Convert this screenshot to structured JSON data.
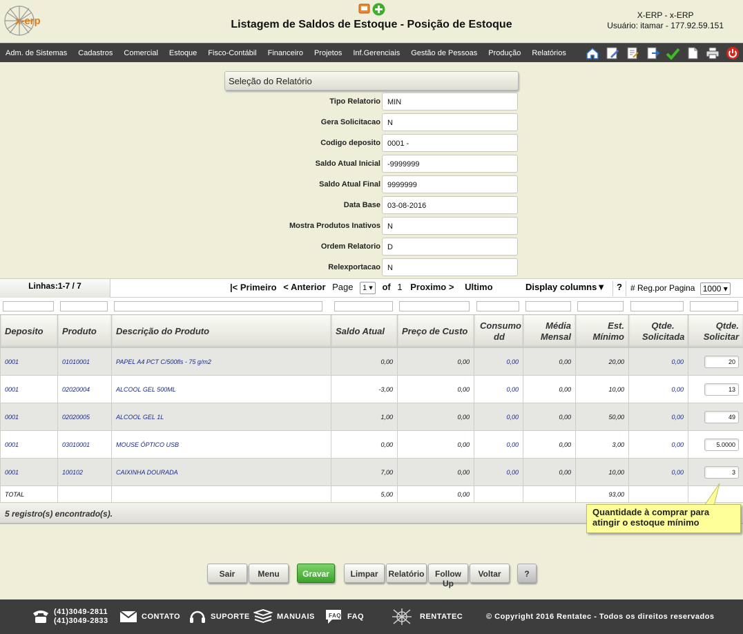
{
  "header": {
    "logo_text": "x-erp",
    "title": "Listagem de Saldos de Estoque - Posição de Estoque",
    "system": "X-ERP - x-ERP",
    "user": "Usuário: itamar - 177.92.59.151"
  },
  "menu": [
    "Adm. de Sistemas",
    "Cadastros",
    "Comercial",
    "Estoque",
    "Fisco-Contábil",
    "Financeiro",
    "Projetos",
    "Inf.Gerenciais",
    "Gestão de Pessoas",
    "Produção",
    "Relatórios"
  ],
  "toolbar_icons": [
    "home-icon",
    "edit-icon",
    "document-edit-icon",
    "export-icon",
    "check-icon",
    "page-icon",
    "print-icon",
    "power-icon"
  ],
  "selection": {
    "title": "Seleção do Relatório",
    "fields": [
      {
        "label": "Tipo Relatorio",
        "value": "MIN"
      },
      {
        "label": "Gera Solicitacao",
        "value": "N"
      },
      {
        "label": "Codigo deposito",
        "value": "0001 -"
      },
      {
        "label": "Saldo Atual Inicial",
        "value": "-9999999"
      },
      {
        "label": "Saldo Atual Final",
        "value": "9999999"
      },
      {
        "label": "Data Base",
        "value": "03-08-2016"
      },
      {
        "label": "Mostra Produtos Inativos",
        "value": "N"
      },
      {
        "label": "Ordem Relatorio",
        "value": "D"
      },
      {
        "label": "Relexportacao",
        "value": "N"
      }
    ]
  },
  "pager": {
    "lines": "Linhas:1-7 / 7",
    "first": "|< Primeiro",
    "prev": "< Anterior",
    "page_label": "Page",
    "page": "1",
    "of": "of",
    "total_pages": "1",
    "next": "Proximo >",
    "last": "Ultimo",
    "display_columns": "Display columns▼",
    "help": "?",
    "reg_label": "# Reg.por Pagina",
    "reg_value": "1000"
  },
  "columns": [
    "Deposito",
    "Produto",
    "Descrição do Produto",
    "Saldo Atual",
    "Preço de Custo",
    "Consumo dd",
    "Média Mensal",
    "Est. Mínimo",
    "Qtde. Solicitada",
    "Qtde. Solicitar"
  ],
  "rows": [
    {
      "deposito": "0001",
      "produto": "01010001",
      "descricao": "PAPEL A4 PCT C/500fls - 75 g/m2",
      "saldo": "0,00",
      "custo": "0,00",
      "consumo": "0,00",
      "media": "0,00",
      "minimo": "20,00",
      "solicitada": "0,00",
      "solicitar": "20"
    },
    {
      "deposito": "0001",
      "produto": "02020004",
      "descricao": "ALCOOL GEL 500ML",
      "saldo": "-3,00",
      "custo": "0,00",
      "consumo": "0,00",
      "media": "0,00",
      "minimo": "10,00",
      "solicitada": "0,00",
      "solicitar": "13"
    },
    {
      "deposito": "0001",
      "produto": "02020005",
      "descricao": "ALCOOL GEL 1L",
      "saldo": "1,00",
      "custo": "0,00",
      "consumo": "0,00",
      "media": "0,00",
      "minimo": "50,00",
      "solicitada": "0,00",
      "solicitar": "49"
    },
    {
      "deposito": "0001",
      "produto": "03010001",
      "descricao": "MOUSE ÓPTICO USB",
      "saldo": "0,00",
      "custo": "0,00",
      "consumo": "0,00",
      "media": "0,00",
      "minimo": "3,00",
      "solicitada": "0,00",
      "solicitar": "5.0000"
    },
    {
      "deposito": "0001",
      "produto": "100102",
      "descricao": "CAIXINHA DOURADA",
      "saldo": "7,00",
      "custo": "0,00",
      "consumo": "0,00",
      "media": "0,00",
      "minimo": "10,00",
      "solicitada": "0,00",
      "solicitar": "3"
    }
  ],
  "total": {
    "label": "TOTAL",
    "saldo": "5,00",
    "custo": "0,00",
    "minimo": "93,00"
  },
  "found": "5 registro(s) encontrado(s).",
  "tooltip": "Quantidade à comprar para atingir o estoque mínimo",
  "buttons": [
    "Sair",
    "Menu",
    "Gravar",
    "Limpar",
    "Relatório",
    "Follow Up",
    "Voltar",
    "?"
  ],
  "footer": {
    "phone1": "(41)3049-2811",
    "phone2": "(41)3049-2833",
    "contato": "CONTATO",
    "suporte": "SUPORTE",
    "manuais": "MANUAIS",
    "faq": "FAQ",
    "rentatec": "RENTATEC",
    "copyright": "© Copyright 2016 Rentatec - Todos os direitos reservados"
  },
  "colors": {
    "menubar": "#3f3f3f",
    "background": "#efefd9",
    "link_blue": "#1a2a8c",
    "save_green": "#3da22c",
    "tooltip": "#ffff99"
  }
}
